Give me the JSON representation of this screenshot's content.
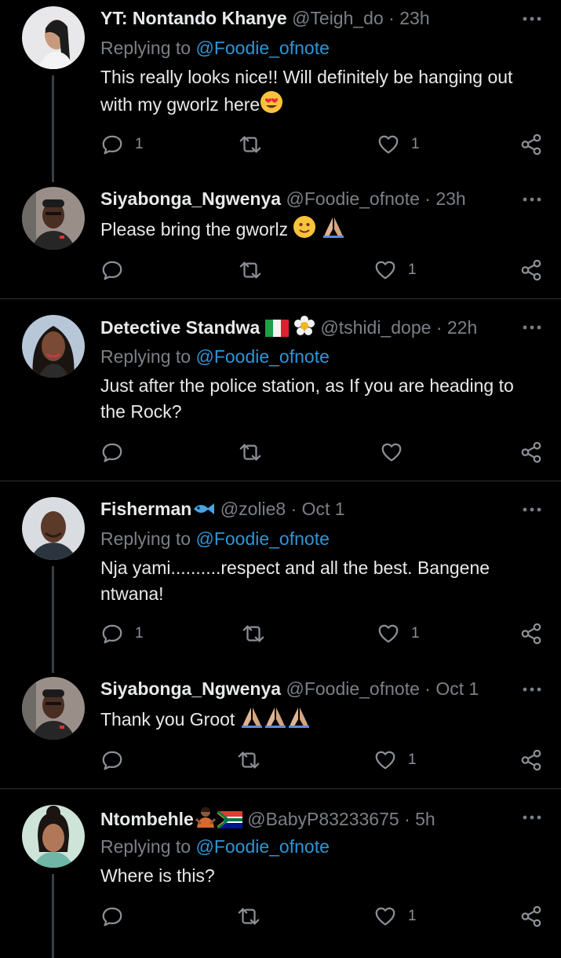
{
  "tweets": [
    {
      "name": "YT: Nontando Khanye",
      "handle": "@Teigh_do",
      "time": "23h",
      "replying_prefix": "Replying to",
      "replying_to": "@Foodie_ofnote",
      "text_line1": "This really looks nice!! Will definitely be hanging out",
      "text_line2": "with my gworlz here",
      "reply_count": "1",
      "like_count": "1"
    },
    {
      "name": "Siyabonga_Ngwenya",
      "handle": "@Foodie_ofnote",
      "time": "23h",
      "text_line1": "Please bring the gworlz",
      "like_count": "1"
    },
    {
      "name": "Detective Standwa",
      "handle": "@tshidi_dope",
      "time": "22h",
      "replying_prefix": "Replying to",
      "replying_to": "@Foodie_ofnote",
      "text_line1": "Just after the police station, as If you are heading to",
      "text_line2": "the Rock?"
    },
    {
      "name": "Fisherman",
      "handle": "@zolie8",
      "time": "Oct 1",
      "replying_prefix": "Replying to",
      "replying_to": "@Foodie_ofnote",
      "text_line1": "Nja yami..........respect and all the best. Bangene",
      "text_line2": "ntwana!",
      "reply_count": "1",
      "like_count": "1"
    },
    {
      "name": "Siyabonga_Ngwenya",
      "handle": "@Foodie_ofnote",
      "time": "Oct 1",
      "text_line1": "Thank you Groot",
      "like_count": "1"
    },
    {
      "name": "Ntombehle",
      "handle": "@BabyP83233675",
      "time": "5h",
      "replying_prefix": "Replying to",
      "replying_to": "@Foodie_ofnote",
      "text_line1": "Where is this?",
      "like_count": "1"
    }
  ],
  "separator": "·",
  "icons": {
    "reply": "reply-icon",
    "retweet": "retweet-icon",
    "like": "heart-icon",
    "share": "share-icon",
    "more": "more-options-icon"
  },
  "colors": {
    "background": "#000000",
    "link": "#2f95d6",
    "muted": "#7a8086",
    "text": "#e7e9ea"
  }
}
